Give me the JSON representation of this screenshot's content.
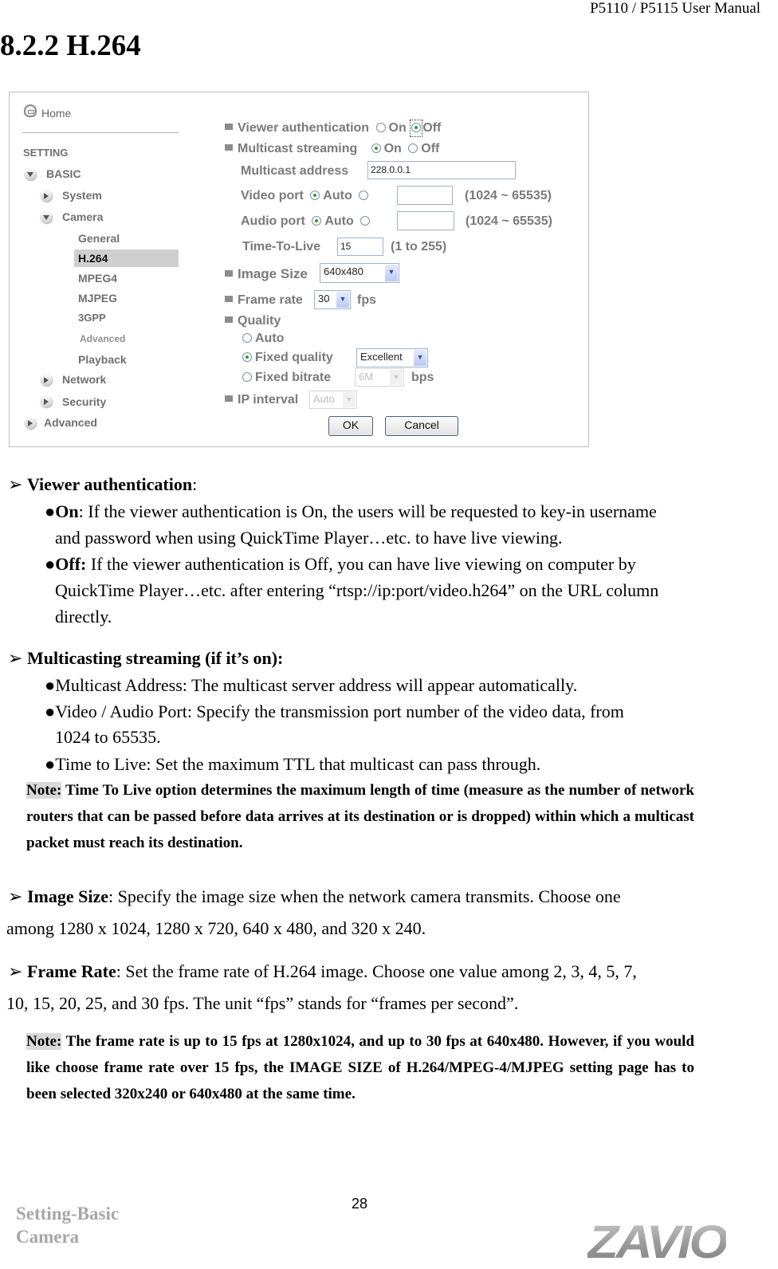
{
  "header": {
    "manual_title": "P5110 / P5115 User Manual",
    "section_title": "8.2.2 H.264"
  },
  "screenshot": {
    "sidebar": {
      "home": "Home",
      "setting": "SETTING",
      "basic": "BASIC",
      "system": "System",
      "camera": "Camera",
      "camera_items": [
        "General",
        "H.264",
        "MPEG4",
        "MJPEG",
        "3GPP",
        "Advanced",
        "Playback"
      ],
      "selected": "H.264",
      "network": "Network",
      "security": "Security",
      "advanced": "Advanced"
    },
    "form": {
      "viewer_auth": {
        "label": "Viewer authentication",
        "on": "On",
        "off": "Off",
        "value": "Off"
      },
      "multicast": {
        "label": "Multicast streaming",
        "on": "On",
        "off": "Off",
        "value": "On"
      },
      "multicast_address": {
        "label": "Multicast address",
        "value": "228.0.0.1"
      },
      "video_port": {
        "label": "Video port",
        "auto": "Auto",
        "value": "",
        "range": "(1024 ~ 65535)"
      },
      "audio_port": {
        "label": "Audio port",
        "auto": "Auto",
        "value": "",
        "range": "(1024 ~ 65535)"
      },
      "ttl": {
        "label": "Time-To-Live",
        "value": "15",
        "range": "(1 to 255)"
      },
      "image_size": {
        "label": "Image Size",
        "value": "640x480"
      },
      "frame_rate": {
        "label": "Frame rate",
        "value": "30",
        "unit": "fps"
      },
      "quality": {
        "label": "Quality",
        "auto": "Auto",
        "fixed_quality": "Fixed quality",
        "fixed_quality_value": "Excellent",
        "fixed_bitrate": "Fixed bitrate",
        "fixed_bitrate_value": "6M",
        "bitrate_unit": "bps"
      },
      "ip_interval": {
        "label": "IP interval",
        "value": "Auto"
      },
      "ok": "OK",
      "cancel": "Cancel"
    }
  },
  "content": {
    "viewer_auth": {
      "heading": "Viewer authentication",
      "on_label": "On",
      "on_text1": ": If the viewer authentication is On, the users will be requested to key-in username",
      "on_text2": "and password when using QuickTime Player…etc. to have live viewing.",
      "off_label": "Off:",
      "off_text1": " If the viewer authentication is Off, you can have live viewing on computer by",
      "off_text2": "QuickTime Player…etc. after entering “rtsp://ip:port/video.h264” on the URL column",
      "off_text3": "directly."
    },
    "multicast": {
      "heading": "Multicasting streaming (if it’s on):",
      "item1": "Multicast Address: The multicast server address will appear automatically.",
      "item2a": "Video / Audio Port: Specify the transmission port number of the video data, from",
      "item2b": "1024 to 65535.",
      "item3": "Time to Live: Set the maximum TTL that multicast can pass through.",
      "note_label": "Note:",
      "note_text": " Time To Live option determines the maximum length of time (measure as the number of network routers that can be passed before data arrives at its destination or is dropped) within which a multicast packet must reach its destination."
    },
    "image_size": {
      "heading": "Image Size",
      "text1": ": Specify the image size when the network camera transmits. Choose one",
      "text2": "among 1280 x 1024, 1280 x 720, 640 x 480, and 320 x 240."
    },
    "frame_rate": {
      "heading": "Frame Rate",
      "text1": ": Set the frame rate of H.264 image. Choose one value among 2, 3, 4, 5, 7,",
      "text2": "10, 15, 20, 25, and 30 fps. The unit “fps” stands for “frames per second”.",
      "note_label": "Note:",
      "note_text": " The frame rate is up to 15 fps at 1280x1024, and up to 30 fps at 640x480. However, if you would like choose frame rate over 15 fps, the IMAGE SIZE of H.264/MPEG-4/MJPEG setting page has to been selected 320x240 or 640x480 at the same time."
    }
  },
  "footer": {
    "section_line1": "Setting-Basic",
    "section_line2": "Camera",
    "page_number": "28",
    "logo": "ZAVIO"
  }
}
